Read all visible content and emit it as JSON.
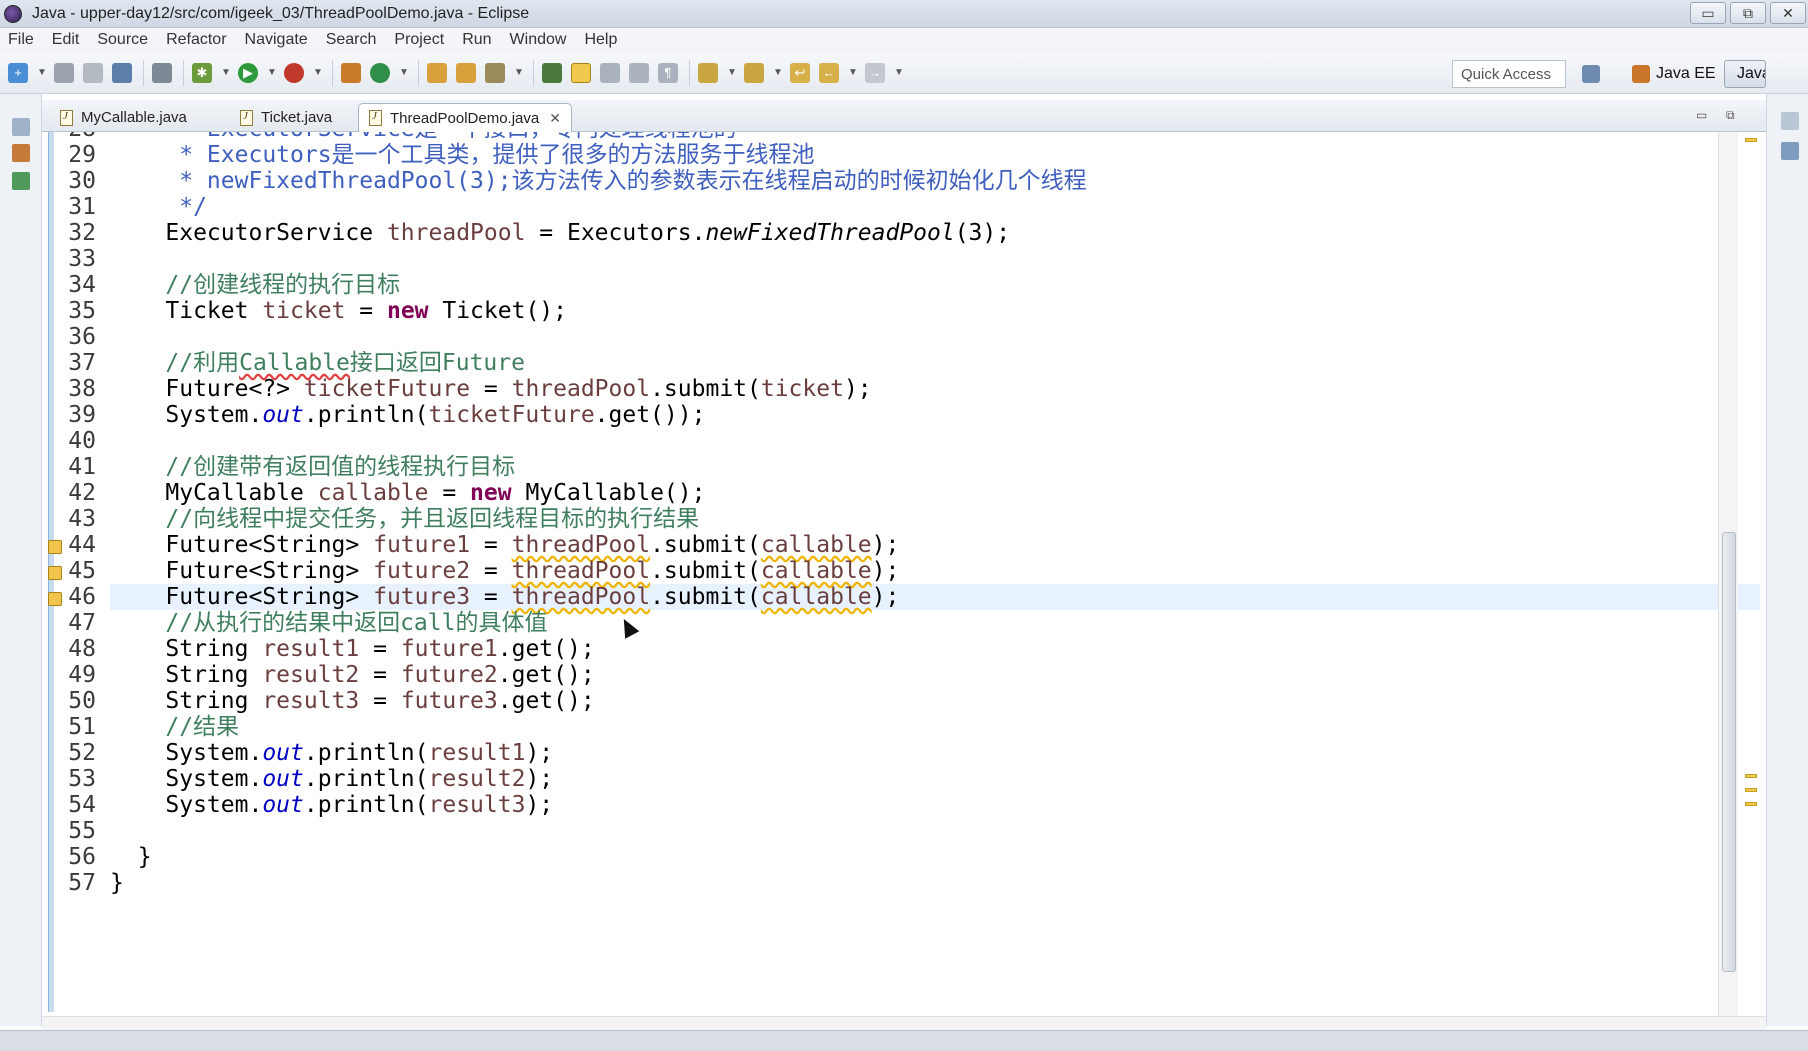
{
  "window": {
    "title": "Java - upper-day12/src/com/igeek_03/ThreadPoolDemo.java - Eclipse",
    "controls": [
      "▭",
      "⧉",
      "✕"
    ]
  },
  "menu": [
    "File",
    "Edit",
    "Source",
    "Refactor",
    "Navigate",
    "Search",
    "Project",
    "Run",
    "Window",
    "Help"
  ],
  "toolbar": {
    "quick_access": "Quick Access",
    "perspectives": [
      {
        "label": "Java EE",
        "active": false
      },
      {
        "label": "Java",
        "active": true
      }
    ]
  },
  "tabs": [
    {
      "label": "MyCallable.java",
      "active": false
    },
    {
      "label": "Ticket.java",
      "active": false
    },
    {
      "label": "ThreadPoolDemo.java",
      "active": true,
      "close": "✕"
    }
  ],
  "editor": {
    "lines": [
      {
        "n": "28",
        "text": "     * ExecutorService是一个接口，专门处理线程池的"
      },
      {
        "n": "29",
        "text": "     * Executors是一个工具类，提供了很多的方法服务于线程池"
      },
      {
        "n": "30",
        "text": "     * newFixedThreadPool(3);该方法传入的参数表示在线程启动的时候初始化几个线程"
      },
      {
        "n": "31",
        "text": "     */"
      },
      {
        "n": "32",
        "text": "    ExecutorService threadPool = Executors.newFixedThreadPool(3);"
      },
      {
        "n": "33",
        "text": ""
      },
      {
        "n": "34",
        "text": "    //创建线程的执行目标"
      },
      {
        "n": "35",
        "text": "    Ticket ticket = new Ticket();"
      },
      {
        "n": "36",
        "text": ""
      },
      {
        "n": "37",
        "text": "    //利用Callable接口返回Future"
      },
      {
        "n": "38",
        "text": "    Future<?> ticketFuture = threadPool.submit(ticket);"
      },
      {
        "n": "39",
        "text": "    System.out.println(ticketFuture.get());"
      },
      {
        "n": "40",
        "text": ""
      },
      {
        "n": "41",
        "text": "    //创建带有返回值的线程执行目标"
      },
      {
        "n": "42",
        "text": "    MyCallable callable = new MyCallable();"
      },
      {
        "n": "43",
        "text": "    //向线程中提交任务，并且返回线程目标的执行结果"
      },
      {
        "n": "44",
        "text": "    Future<String> future1 = threadPool.submit(callable);"
      },
      {
        "n": "45",
        "text": "    Future<String> future2 = threadPool.submit(callable);"
      },
      {
        "n": "46",
        "text": "    Future<String> future3 = threadPool.submit(callable);"
      },
      {
        "n": "47",
        "text": "    //从执行的结果中返回call的具体值"
      },
      {
        "n": "48",
        "text": "    String result1 = future1.get();"
      },
      {
        "n": "49",
        "text": "    String result2 = future2.get();"
      },
      {
        "n": "50",
        "text": "    String result3 = future3.get();"
      },
      {
        "n": "51",
        "text": "    //结果"
      },
      {
        "n": "52",
        "text": "    System.out.println(result1);"
      },
      {
        "n": "53",
        "text": "    System.out.println(result2);"
      },
      {
        "n": "54",
        "text": "    System.out.println(result3);"
      },
      {
        "n": "55",
        "text": ""
      },
      {
        "n": "56",
        "text": "  }"
      },
      {
        "n": "57",
        "text": "}"
      }
    ],
    "current_line": "46",
    "warning_lines": [
      "44",
      "45",
      "46"
    ]
  },
  "colors": {
    "keyword": "#7f0055",
    "comment": "#3f7f5f",
    "javadoc": "#3f5fbf",
    "field": "#0000c0",
    "local_var": "#6a3e3e",
    "current_line_bg": "#e8f2fe"
  }
}
